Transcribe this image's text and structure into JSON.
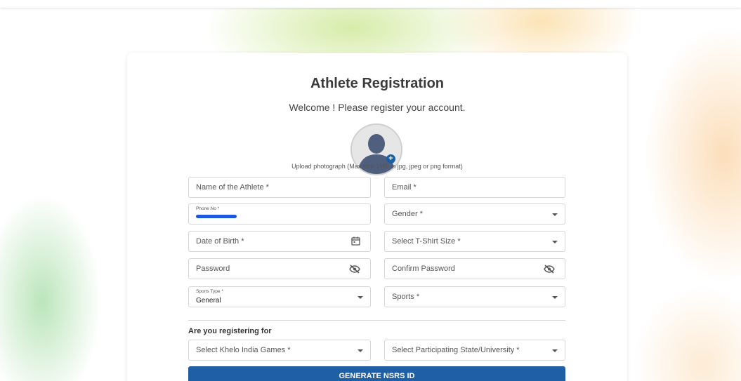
{
  "page": {
    "title": "Athlete Registration",
    "subtitle": "Welcome ! Please register your account.",
    "upload_hint": "Upload photograph (Max size 1MB in jpg, jpeg or png format)"
  },
  "fields": {
    "name": "Name of the Athlete *",
    "email": "Email *",
    "phone_label": "Phone No *",
    "gender": "Gender *",
    "dob": "Date of Birth *",
    "tshirt": "Select T-Shirt Size *",
    "password": "Password",
    "confirm_password": "Confirm Password",
    "sports_type_label": "Sports Type *",
    "sports_type_value": "General",
    "sports": "Sports *"
  },
  "registering": {
    "label": "Are you registering for",
    "games": "Select Khelo India Games *",
    "state": "Select Participating State/University *"
  },
  "actions": {
    "generate": "GENERATE NSRS ID"
  },
  "colors": {
    "primary": "#1f5fa6",
    "avatar_fill": "#4f5f7d",
    "redaction": "#1d58d8"
  },
  "icons": {
    "avatar": "user-silhouette-icon",
    "add_photo": "plus-circle-icon",
    "calendar": "calendar-icon",
    "password_visibility": "eye-off-icon",
    "dropdown": "chevron-down-icon"
  }
}
